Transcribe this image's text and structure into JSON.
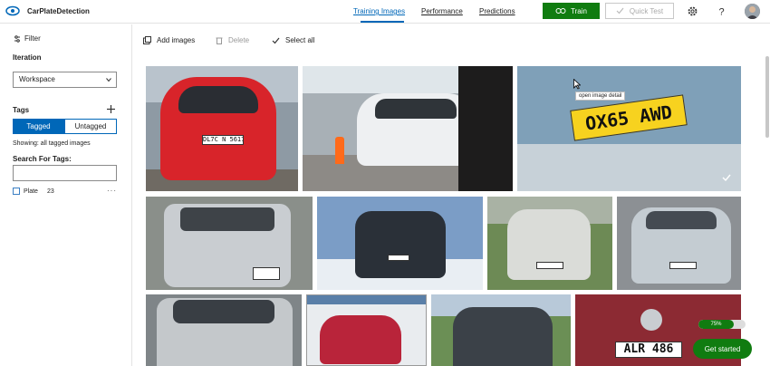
{
  "app": {
    "title": "CarPlateDetection"
  },
  "nav": {
    "tabs": [
      {
        "label": "Training Images",
        "active": true
      },
      {
        "label": "Performance",
        "active": false
      },
      {
        "label": "Predictions",
        "active": false
      }
    ]
  },
  "toolbar": {
    "train_label": "Train",
    "quick_test_label": "Quick Test"
  },
  "sidebar": {
    "filter_label": "Filter",
    "iteration_title": "Iteration",
    "iteration_value": "Workspace",
    "tags_title": "Tags",
    "tagged_label": "Tagged",
    "untagged_label": "Untagged",
    "showing_text": "Showing: all tagged images",
    "search_tags_label": "Search For Tags:",
    "search_tags_value": "",
    "tags": [
      {
        "name": "Plate",
        "count": "23"
      }
    ]
  },
  "actions": {
    "add_images": "Add images",
    "delete": "Delete",
    "select_all": "Select all"
  },
  "images": {
    "plates": [
      "DL7C N 5617",
      "",
      "OX65 AWD",
      "",
      "",
      "",
      "",
      "",
      "",
      "",
      "ALR 486"
    ],
    "tooltip": "open image detail"
  },
  "progress": {
    "percent": 75,
    "label": "75%"
  },
  "get_started_label": "Get started",
  "colors": {
    "accent": "#0067b8",
    "train_green": "#107c10"
  }
}
